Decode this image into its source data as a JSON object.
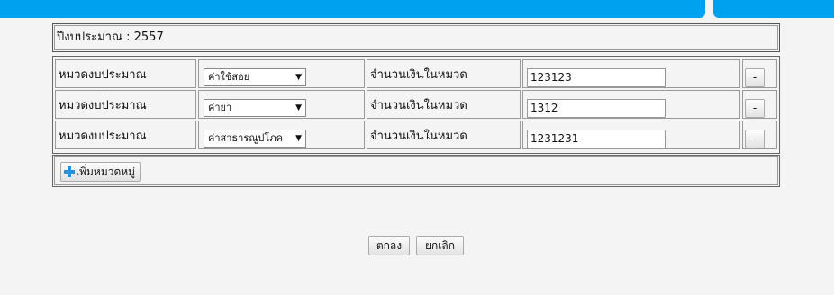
{
  "fiscal_year": {
    "label": "ปีงบประมาณ : 2557"
  },
  "categories": {
    "rows": [
      {
        "category_label": "หมวดงบประมาณ",
        "selected": "ค่าใช้สอย",
        "amount_label": "จำนวนเงินในหมวด",
        "amount": "123123",
        "remove_label": "-"
      },
      {
        "category_label": "หมวดงบประมาณ",
        "selected": "ค่ายา",
        "amount_label": "จำนวนเงินในหมวด",
        "amount": "1312",
        "remove_label": "-"
      },
      {
        "category_label": "หมวดงบประมาณ",
        "selected": "ค่าสาธารณูปโภค",
        "amount_label": "จำนวนเงินในหมวด",
        "amount": "1231231",
        "remove_label": "-"
      }
    ],
    "add_label": "เพิ่มหมวดหมู่"
  },
  "actions": {
    "ok_label": "ตกลง",
    "cancel_label": "ยกเลิก"
  },
  "colors": {
    "topbar": "#00a2f0"
  }
}
